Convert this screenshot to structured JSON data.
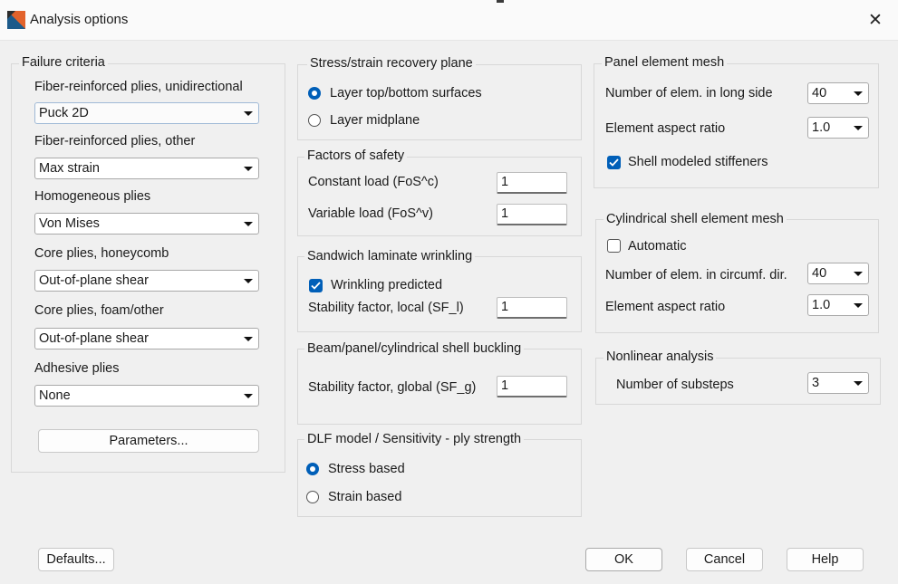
{
  "window": {
    "title": "Analysis options",
    "close_glyph": "✕"
  },
  "failure": {
    "legend": "Failure criteria",
    "fields": [
      {
        "label": "Fiber-reinforced plies, unidirectional",
        "value": "Puck 2D"
      },
      {
        "label": "Fiber-reinforced plies, other",
        "value": "Max strain"
      },
      {
        "label": "Homogeneous plies",
        "value": "Von Mises"
      },
      {
        "label": "Core plies, honeycomb",
        "value": "Out-of-plane shear"
      },
      {
        "label": "Core plies, foam/other",
        "value": "Out-of-plane shear"
      },
      {
        "label": "Adhesive plies",
        "value": "None"
      }
    ],
    "parameters_button": "Parameters..."
  },
  "recovery": {
    "legend": "Stress/strain recovery plane",
    "option_top_bottom": "Layer top/bottom surfaces",
    "option_midplane": "Layer midplane",
    "selected": "Layer top/bottom surfaces"
  },
  "safety": {
    "legend": "Factors of safety",
    "constant_label": "Constant load (FoS^c)",
    "constant_value": "1",
    "variable_label": "Variable load (FoS^v)",
    "variable_value": "1"
  },
  "wrinkling": {
    "legend": "Sandwich laminate wrinkling",
    "predicted_label": "Wrinkling predicted",
    "predicted_checked": true,
    "stability_label": "Stability factor, local (SF_l)",
    "stability_value": "1"
  },
  "buckling": {
    "legend": "Beam/panel/cylindrical shell buckling",
    "stability_label": "Stability factor, global (SF_g)",
    "stability_value": "1"
  },
  "dlf": {
    "legend": "DLF model / Sensitivity - ply strength",
    "option_stress": "Stress based",
    "option_strain": "Strain based",
    "selected": "Stress based"
  },
  "panel_mesh": {
    "legend": "Panel element mesh",
    "long_side_label": "Number of elem. in long side",
    "long_side_value": "40",
    "aspect_label": "Element aspect ratio",
    "aspect_value": "1.0",
    "stiffeners_label": "Shell modeled stiffeners",
    "stiffeners_checked": true
  },
  "cyl_mesh": {
    "legend": "Cylindrical shell element mesh",
    "automatic_label": "Automatic",
    "automatic_checked": false,
    "circumf_label": "Number of elem. in circumf. dir.",
    "circumf_value": "40",
    "aspect_label": "Element aspect ratio",
    "aspect_value": "1.0"
  },
  "nonlinear": {
    "legend": "Nonlinear analysis",
    "substeps_label": "Number of substeps",
    "substeps_value": "3"
  },
  "footer": {
    "defaults": "Defaults...",
    "ok": "OK",
    "cancel": "Cancel",
    "help": "Help"
  },
  "colors": {
    "accent": "#005fb8",
    "background": "#f0f0f0",
    "icon_orange": "#e2622b",
    "icon_blue": "#1c5a8a"
  }
}
